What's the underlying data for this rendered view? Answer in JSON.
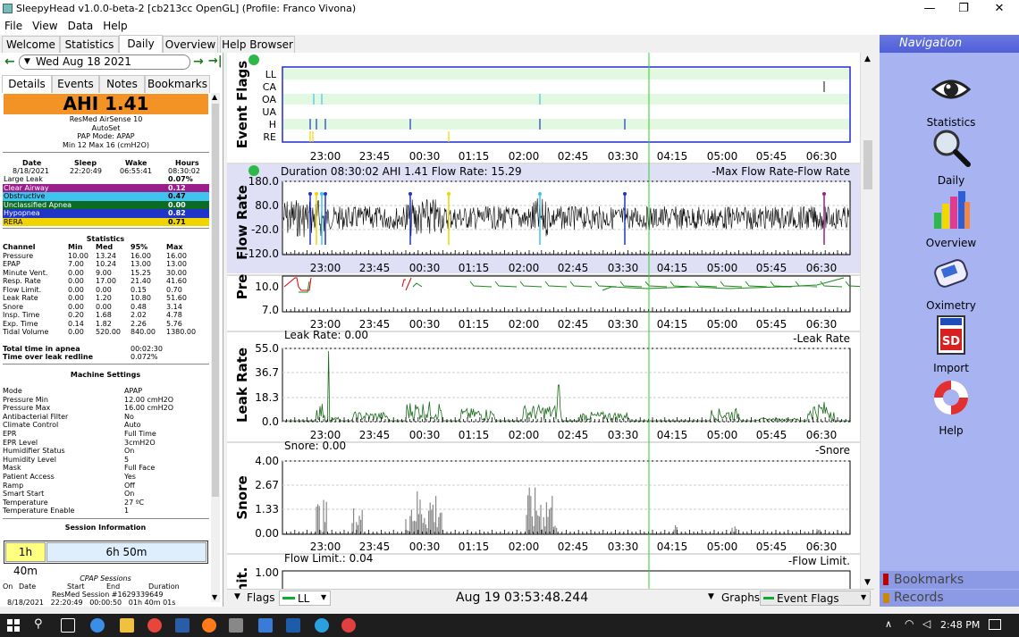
{
  "window": {
    "title": "SleepyHead v1.0.0-beta-2 [cb213cc OpenGL] (Profile: Franco Vivona)"
  },
  "menu": [
    "File",
    "View",
    "Data",
    "Help"
  ],
  "tabs": [
    "Welcome",
    "Statistics",
    "Daily",
    "Overview",
    "Help Browser"
  ],
  "date_nav": {
    "date": "Wed Aug 18 2021"
  },
  "subtabs": [
    "Details",
    "Events",
    "Notes",
    "Bookmarks"
  ],
  "ahi": {
    "label": "AHI 1.41"
  },
  "machine": {
    "name": "ResMed AirSense 10",
    "mode": "AutoSet",
    "pap_mode": "PAP Mode: APAP",
    "pressure": "Min 12 Max 16 (cmH2O)"
  },
  "session_summary": {
    "headers": [
      "Date",
      "Sleep",
      "Wake",
      "Hours"
    ],
    "values": [
      "8/18/2021",
      "22:20:49",
      "06:55:41",
      "08:30:02"
    ]
  },
  "event_rates": [
    {
      "name": "Large Leak",
      "value": "0.07%",
      "bg": "#ffffff",
      "fg": "#000000"
    },
    {
      "name": "Clear Airway",
      "value": "0.12",
      "bg": "#9b1d8a",
      "fg": "#ffffff"
    },
    {
      "name": "Obstructive",
      "value": "0.47",
      "bg": "#3fc3ef",
      "fg": "#000000"
    },
    {
      "name": "Unclassified Apnea",
      "value": "0.00",
      "bg": "#0b6b24",
      "fg": "#ffffff"
    },
    {
      "name": "Hypopnea",
      "value": "0.82",
      "bg": "#1e35c8",
      "fg": "#ffffff"
    },
    {
      "name": "RERA",
      "value": "0.71",
      "bg": "#f0d400",
      "fg": "#000000"
    }
  ],
  "statistics": {
    "title": "Statistics",
    "headers": [
      "Channel",
      "Min",
      "Med",
      "95%",
      "Max"
    ],
    "rows": [
      [
        "Pressure",
        "10.00",
        "13.24",
        "16.00",
        "16.00"
      ],
      [
        "EPAP",
        "7.00",
        "10.24",
        "13.00",
        "13.00"
      ],
      [
        "Minute Vent.",
        "0.00",
        "9.00",
        "15.25",
        "30.00"
      ],
      [
        "Resp. Rate",
        "0.00",
        "17.00",
        "21.40",
        "41.60"
      ],
      [
        "Flow Limit.",
        "0.00",
        "0.00",
        "0.15",
        "0.70"
      ],
      [
        "Leak Rate",
        "0.00",
        "1.20",
        "10.80",
        "51.60"
      ],
      [
        "Snore",
        "0.00",
        "0.00",
        "0.48",
        "3.14"
      ],
      [
        "Insp. Time",
        "0.20",
        "1.68",
        "2.02",
        "4.78"
      ],
      [
        "Exp. Time",
        "0.14",
        "1.82",
        "2.26",
        "5.76"
      ],
      [
        "Tidal Volume",
        "0.00",
        "520.00",
        "840.00",
        "1380.00"
      ]
    ],
    "apnea_label": "Total time in apnea",
    "apnea_value": "00:02:30",
    "leak_label": "Time over leak redline",
    "leak_value": "0.072%"
  },
  "machine_settings": {
    "title": "Machine Settings",
    "rows": [
      [
        "Mode",
        "APAP"
      ],
      [
        "Pressure Min",
        "12.00 cmH2O"
      ],
      [
        "Pressure Max",
        "16.00 cmH2O"
      ],
      [
        "Antibacterial Filter",
        "No"
      ],
      [
        "Climate Control",
        "Auto"
      ],
      [
        "EPR",
        "Full Time"
      ],
      [
        "EPR Level",
        "3cmH2O"
      ],
      [
        "Humidifier Status",
        "On"
      ],
      [
        "Humidity Level",
        "5"
      ],
      [
        "Mask",
        "Full Face"
      ],
      [
        "Patient Access",
        "Yes"
      ],
      [
        "Ramp",
        "Off"
      ],
      [
        "Smart Start",
        "On"
      ],
      [
        "Temperature",
        "27 ºC"
      ],
      [
        "Temperature Enable",
        "1"
      ]
    ]
  },
  "session_info": {
    "title": "Session Information",
    "left": "1h 40m",
    "right": "6h 50m",
    "cpap_title": "CPAP Sessions",
    "headers": [
      "On",
      "Date",
      "Start",
      "End",
      "Duration"
    ],
    "row_name": "ResMed Session #1629339649",
    "row_partial": "8/18/2021   22:20:49   00:00:50   01h 40m 01s"
  },
  "graphs": {
    "time_labels": [
      "23:00",
      "23:45",
      "00:30",
      "01:15",
      "02:00",
      "02:45",
      "03:30",
      "04:15",
      "05:00",
      "05:45",
      "06:30"
    ],
    "event_flags": {
      "title": "Event Flags",
      "rows": [
        "LL",
        "CA",
        "OA",
        "UA",
        "H",
        "RE"
      ]
    },
    "flow_rate": {
      "title": "Flow Rate",
      "header": "Duration 08:30:02 AHI 1.41 Flow Rate: 15.29",
      "right": "-Max Flow Rate-Flow Rate",
      "ticks": [
        "180.0",
        "80.0",
        "-20.0",
        "-120.0"
      ]
    },
    "pressure": {
      "title": "Pre",
      "ticks": [
        "10.0",
        "7.0"
      ]
    },
    "leak_rate": {
      "title": "Leak Rate",
      "header": "Leak Rate: 0.00",
      "right": "-Leak Rate",
      "ticks": [
        "55.0",
        "36.7",
        "18.3",
        "0.0"
      ]
    },
    "snore": {
      "title": "Snore",
      "header": "Snore: 0.00",
      "right": "-Snore",
      "ticks": [
        "4.00",
        "2.67",
        "1.33",
        "0.00"
      ]
    },
    "flow_limit": {
      "title": "nit.",
      "header": "Flow Limit.: 0.04",
      "right": "-Flow Limit.",
      "ticks": [
        "1.00"
      ]
    }
  },
  "bottom_bar": {
    "flags": "Flags",
    "ll": "LL",
    "time": "Aug 19 03:53:48.244",
    "graphs": "Graphs",
    "event_flags": "Event Flags"
  },
  "navigation": {
    "title": "Navigation",
    "items": [
      "Statistics",
      "Daily",
      "Overview",
      "Oximetry",
      "Import",
      "Help"
    ],
    "bookmarks": "Bookmarks",
    "records": "Records"
  },
  "taskbar": {
    "time": "2:48 PM"
  }
}
